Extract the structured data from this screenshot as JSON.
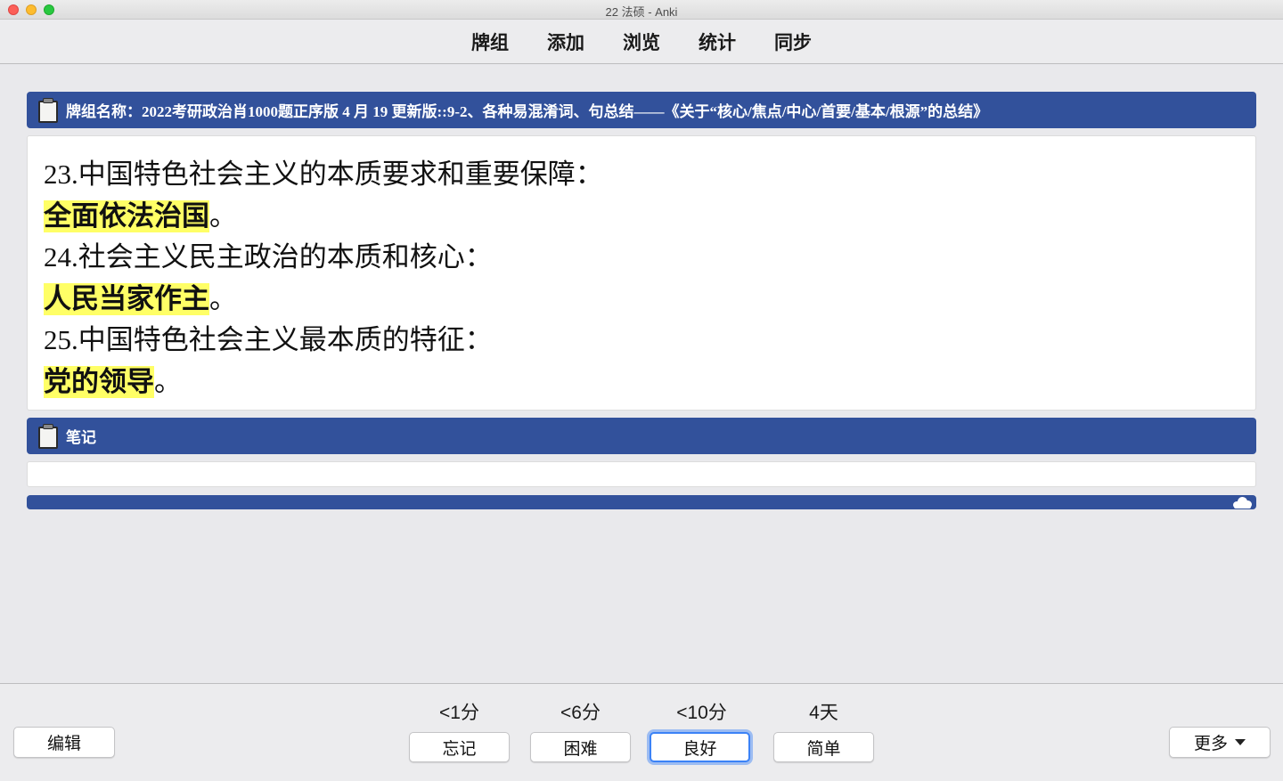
{
  "window": {
    "title": "22 法硕 - Anki"
  },
  "toolbar": {
    "items": [
      {
        "label": "牌组"
      },
      {
        "label": "添加"
      },
      {
        "label": "浏览"
      },
      {
        "label": "统计"
      },
      {
        "label": "同步"
      }
    ]
  },
  "card": {
    "deck_header": "牌组名称：2022考研政治肖1000题正序版 4 月 19 更新版::9-2、各种易混淆词、句总结——《关于“核心/焦点/中心/首要/基本/根源”的总结》",
    "lines": [
      {
        "question": "23.中国特色社会主义的本质要求和重要保障：",
        "answer": "全面依法治国",
        "suffix": "。"
      },
      {
        "question": "24.社会主义民主政治的本质和核心：",
        "answer": "人民当家作主",
        "suffix": "。"
      },
      {
        "question": "25.中国特色社会主义最本质的特征：",
        "answer": "党的领导",
        "suffix": "。"
      }
    ],
    "highlight_color": "#ffff66"
  },
  "notes": {
    "header": "笔记",
    "content": ""
  },
  "progress": {
    "fraction": 1.0,
    "color": "#32519b",
    "icon": "cloud-icon"
  },
  "bottom": {
    "edit_label": "编辑",
    "more_label": "更多",
    "ease_buttons": [
      {
        "time": "<1分",
        "label": "忘记"
      },
      {
        "time": "<6分",
        "label": "困难"
      },
      {
        "time": "<10分",
        "label": "良好",
        "focused": true
      },
      {
        "time": "4天",
        "label": "简单"
      }
    ]
  },
  "colors": {
    "banner": "#32519b",
    "background": "#e9e9ec",
    "focus_ring": "#3b82f6"
  }
}
